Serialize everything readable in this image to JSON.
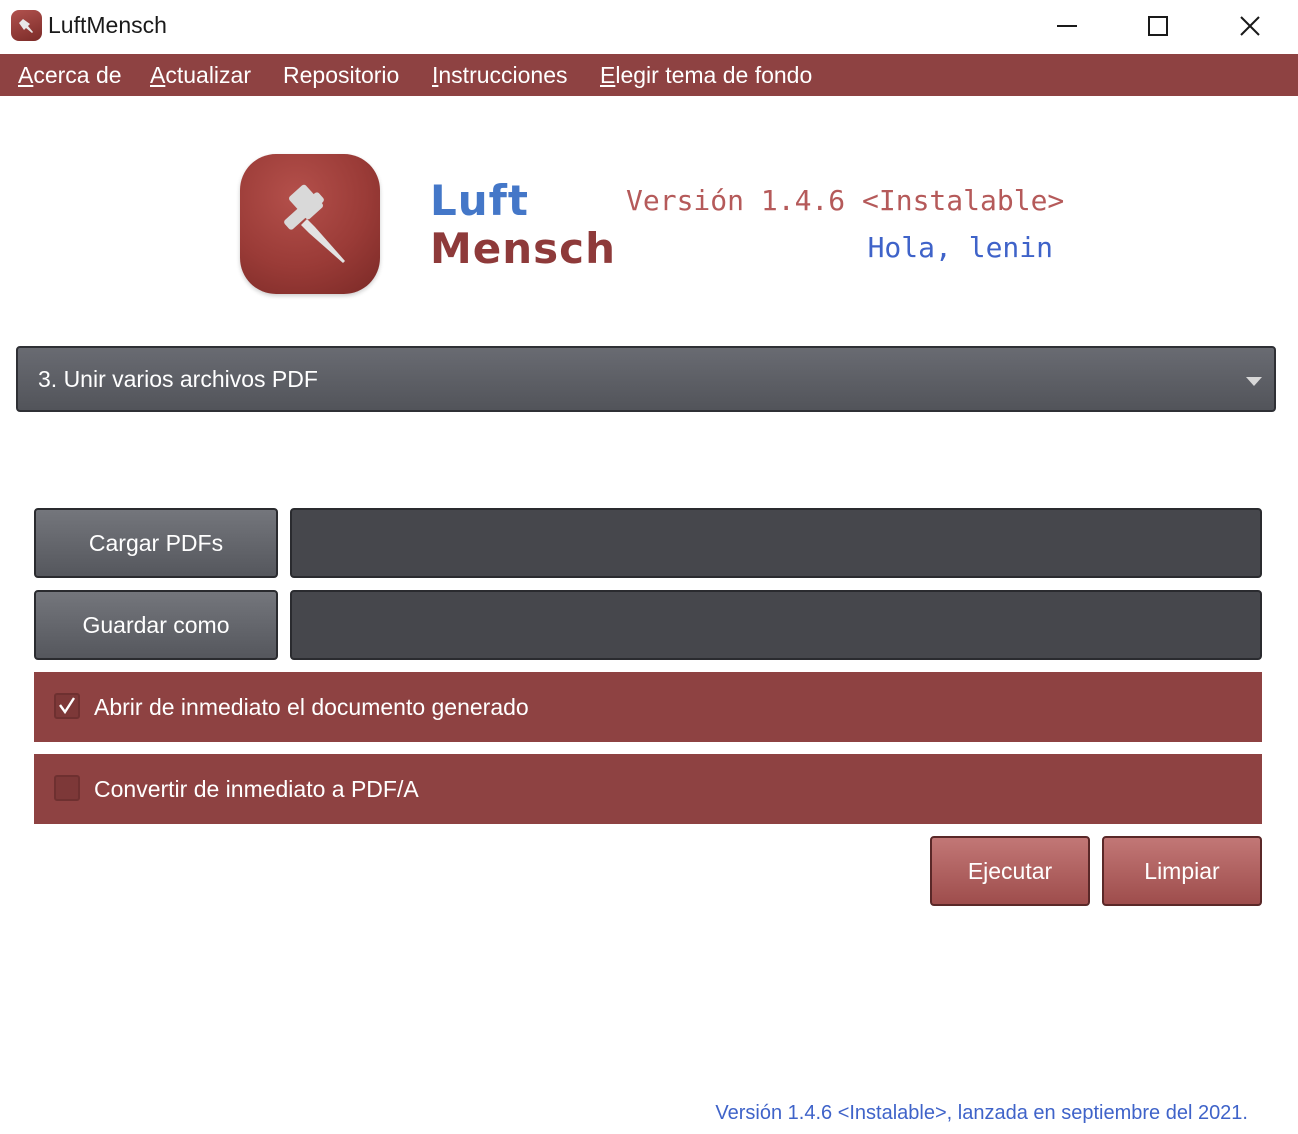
{
  "window": {
    "title": "LuftMensch",
    "controls": [
      "minimize-icon",
      "maximize-icon",
      "close-icon"
    ]
  },
  "menu": {
    "items": [
      {
        "first": "A",
        "rest": "cerca de"
      },
      {
        "first": "A",
        "rest": "ctualizar"
      },
      {
        "first": "",
        "rest": "Repositorio"
      },
      {
        "first": "I",
        "rest": "nstrucciones"
      },
      {
        "first": "E",
        "rest": "legir tema de fondo"
      }
    ]
  },
  "header": {
    "logo_line1": "Luft",
    "logo_line2": "Mensch",
    "version": "Versión 1.4.6 <Instalable>",
    "greeting": "Hola, lenin",
    "logo_icon": "pushpin-icon"
  },
  "task_select": {
    "selected": "3. Unir varios archivos PDF"
  },
  "actions": {
    "load_label": "Cargar PDFs",
    "load_value": "",
    "save_label": "Guardar como",
    "save_value": ""
  },
  "options": {
    "open_doc_label": "Abrir de inmediato el documento generado",
    "open_doc_checked": true,
    "pdfa_label": "Convertir de inmediato a PDF/A",
    "pdfa_checked": false
  },
  "buttons": {
    "run": "Ejecutar",
    "clear": "Limpiar"
  },
  "footer": {
    "text": "Versión 1.4.6 <Instalable>, lanzada en septiembre del 2021."
  },
  "colors": {
    "accent": "#8e4242",
    "blue": "#3f63c9",
    "dark": "#46474c"
  }
}
